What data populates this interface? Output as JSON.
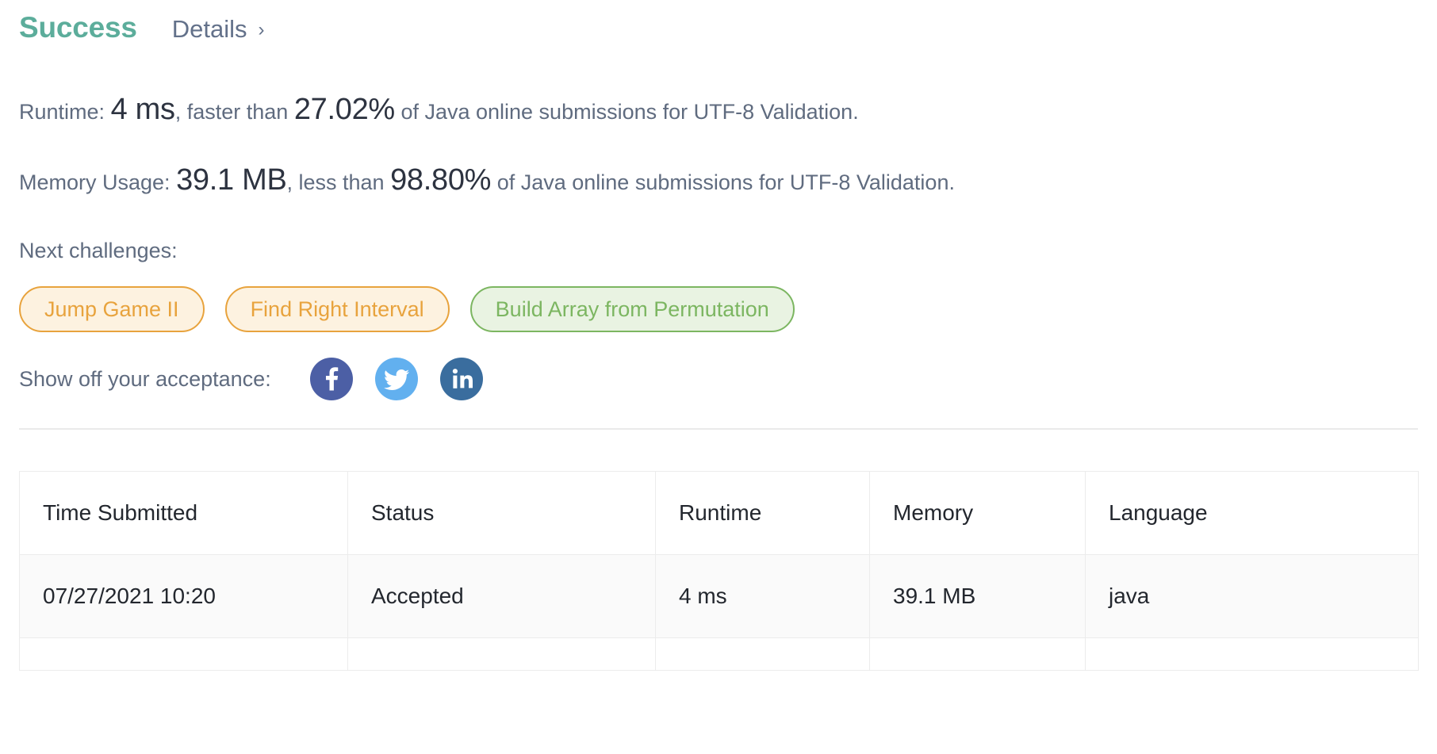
{
  "header": {
    "status": "Success",
    "details_label": "Details",
    "chevron": "›",
    "status_color": "#5cad9b"
  },
  "stats": {
    "runtime": {
      "label": "Runtime:",
      "value": "4 ms",
      "comparator": ", faster than",
      "percent": "27.02%",
      "suffix": "of Java online submissions for UTF-8 Validation."
    },
    "memory": {
      "label": "Memory Usage:",
      "value": "39.1 MB",
      "comparator": ", less than",
      "percent": "98.80%",
      "suffix": "of Java online submissions for UTF-8 Validation."
    }
  },
  "next_challenges": {
    "label": "Next challenges:",
    "items": [
      {
        "label": "Jump Game II",
        "style": "orange"
      },
      {
        "label": "Find Right Interval",
        "style": "orange"
      },
      {
        "label": "Build Array from Permutation",
        "style": "green"
      }
    ]
  },
  "share": {
    "label": "Show off your acceptance:",
    "networks": [
      {
        "name": "facebook",
        "color": "#4c5fa5"
      },
      {
        "name": "twitter",
        "color": "#62b0ef"
      },
      {
        "name": "linkedin",
        "color": "#3a6d9e"
      }
    ]
  },
  "submissions_table": {
    "columns": [
      "Time Submitted",
      "Status",
      "Runtime",
      "Memory",
      "Language"
    ],
    "rows": [
      {
        "time_submitted": "07/27/2021 10:20",
        "status": "Accepted",
        "runtime": "4 ms",
        "memory": "39.1 MB",
        "language": "java"
      }
    ]
  }
}
